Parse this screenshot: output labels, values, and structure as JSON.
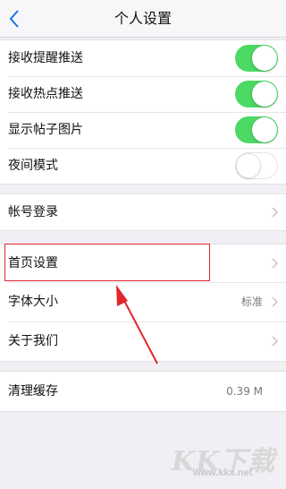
{
  "header": {
    "back_icon": "chevron-left-icon",
    "title": "个人设置"
  },
  "colors": {
    "toggle_on": "#4cd964",
    "highlight": "#e0262c",
    "background": "#efeff4"
  },
  "notifications": {
    "items": [
      {
        "label": "接收提醒推送",
        "toggle": true
      },
      {
        "label": "接收热点推送",
        "toggle": true
      },
      {
        "label": "显示帖子图片",
        "toggle": true
      },
      {
        "label": "夜间模式",
        "toggle": false
      }
    ]
  },
  "account": {
    "login_label": "帐号登录"
  },
  "settings": {
    "home_label": "首页设置",
    "font_label": "字体大小",
    "font_value": "标准",
    "about_label": "关于我们"
  },
  "cache": {
    "clear_label": "清理缓存",
    "size_value": "0.39 M"
  },
  "watermark": {
    "brand": "KK下载",
    "url": "www.kkx.net"
  }
}
